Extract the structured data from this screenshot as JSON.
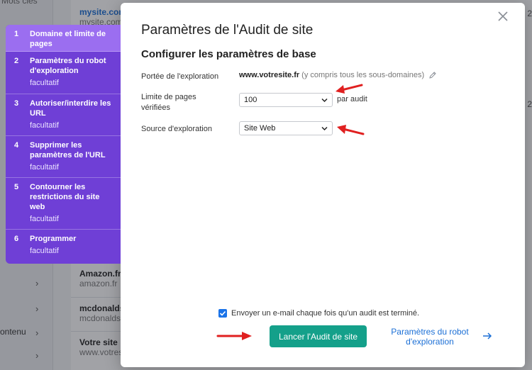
{
  "background": {
    "left_fragments": [
      "Mots clés",
      "ontenu"
    ],
    "rows": [
      {
        "name": "mysite.com",
        "url": "mysite.com"
      },
      {
        "name": "Amazon.fr",
        "url": "amazon.fr"
      },
      {
        "name": "mcdonalds.",
        "url": "mcdonalds.f"
      },
      {
        "name": "Votre site",
        "url": "www.votres"
      }
    ],
    "right_fragments": [
      "2",
      "2"
    ]
  },
  "steps": [
    {
      "num": "1",
      "title": "Domaine et limite de pages",
      "sub": ""
    },
    {
      "num": "2",
      "title": "Paramètres du robot d'exploration",
      "sub": "facultatif"
    },
    {
      "num": "3",
      "title": "Autoriser/interdire les URL",
      "sub": "facultatif"
    },
    {
      "num": "4",
      "title": "Supprimer les paramètres de l'URL",
      "sub": "facultatif"
    },
    {
      "num": "5",
      "title": "Contourner les restrictions du site web",
      "sub": "facultatif"
    },
    {
      "num": "6",
      "title": "Programmer",
      "sub": "facultatif"
    }
  ],
  "modal": {
    "title": "Paramètres de l'Audit de site",
    "section_title": "Configurer les paramètres de base",
    "scope": {
      "label": "Portée de l'exploration",
      "domain": "www.votresite.fr",
      "hint": "(y compris tous les sous-domaines)"
    },
    "page_limit": {
      "label": "Limite de pages vérifiées",
      "value": "100",
      "suffix": "par audit"
    },
    "source": {
      "label": "Source d'exploration",
      "value": "Site Web"
    },
    "email_checkbox": {
      "label": "Envoyer un e-mail chaque fois qu'un audit est terminé.",
      "checked": true
    },
    "launch_button": "Lancer l'Audit de site",
    "robot_link": "Paramètres du robot d'exploration"
  },
  "colors": {
    "accent_purple": "#6f3fd6",
    "active_step": "#9b6ef0",
    "launch_green": "#14a08a",
    "link_blue": "#1b6fd6",
    "annotation_red": "#e02020"
  },
  "icons": [
    "close-icon",
    "pencil-icon",
    "chevron-down-icon",
    "check-icon",
    "arrow-right-icon",
    "chevron-right-icon"
  ]
}
